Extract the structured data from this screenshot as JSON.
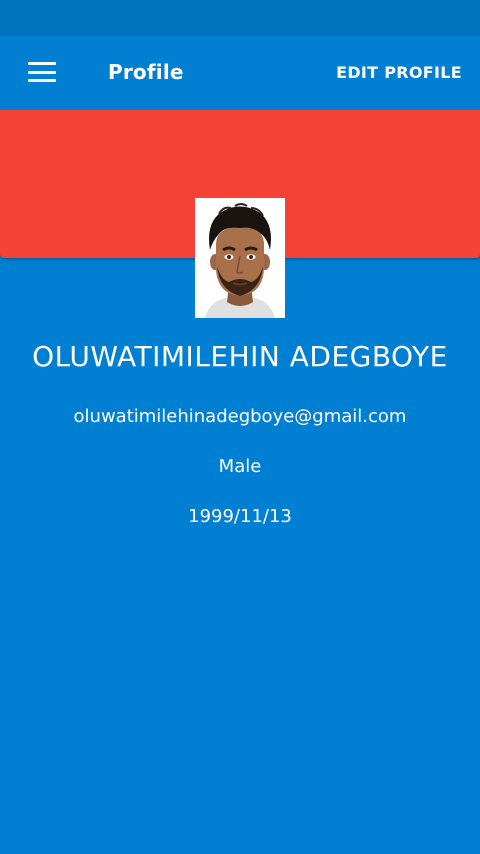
{
  "app_bar": {
    "title": "Profile",
    "action_label": "EDIT PROFILE",
    "menu_icon": "hamburger-menu-icon"
  },
  "profile": {
    "name": "OLUWATIMILEHIN ADEGBOYE",
    "email": "oluwatimilehinadegboye@gmail.com",
    "gender": "Male",
    "date_of_birth": "1999/11/13",
    "avatar": "cartoon-man-avatar"
  },
  "colors": {
    "status_bar": "#0172bd",
    "background": "#0180d3",
    "cover_banner": "#f44336",
    "text": "#ffffff"
  }
}
